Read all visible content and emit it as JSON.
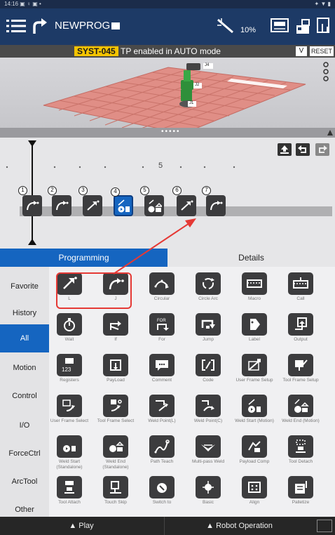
{
  "statusbar": {
    "time": "14:16",
    "left_icons": "▣ ♀ ▣ •",
    "right_icons": "✦ ▼ ▮"
  },
  "topbar": {
    "program_name": "NEWPROG",
    "speed": "10%"
  },
  "alarm": {
    "code": "SYST-045",
    "message": "TP enabled in AUTO mode",
    "expand": "V",
    "reset": "RESET"
  },
  "view3d": {
    "labels": [
      "J4",
      "J2",
      "J1"
    ]
  },
  "splitter": {
    "dots": "•••••"
  },
  "timeline": {
    "ruler_tick": "5",
    "commands": [
      {
        "num": "1",
        "icon": "joint-move-icon"
      },
      {
        "num": "2",
        "icon": "joint-move-icon"
      },
      {
        "num": "3",
        "icon": "linear-move-icon"
      },
      {
        "num": "4",
        "icon": "weld-start-icon"
      },
      {
        "num": "5",
        "icon": "weld-end-icon"
      },
      {
        "num": "6",
        "icon": "linear-move-icon"
      },
      {
        "num": "7",
        "icon": "joint-move-icon"
      }
    ],
    "selected_index": 4
  },
  "tabs": {
    "programming": "Programming",
    "details": "Details"
  },
  "categories": [
    "Favorite",
    "History",
    "All",
    "Motion",
    "Control",
    "I/O",
    "ForceCtrl",
    "ArcTool",
    "Other"
  ],
  "active_category": "All",
  "grid": [
    [
      "L",
      "J",
      "Circular",
      "Circle Arc",
      "Macro",
      "Call"
    ],
    [
      "Wait",
      "If",
      "For",
      "Jump",
      "Label",
      "Output"
    ],
    [
      "Registers",
      "PayLoad",
      "Comment",
      "Code",
      "User Frame Setup",
      "Tool Frame Setup"
    ],
    [
      "User Frame Select",
      "Tool Frame Select",
      "Weld Point(L)",
      "Weld Point(C)",
      "Weld Start (Motion)",
      "Weld End (Motion)"
    ],
    [
      "Weld Start (Standalone)",
      "Weld End (Standalone)",
      "Path Teach",
      "Multi-pass Weld",
      "Payload Comp",
      "Tool Detach"
    ],
    [
      "Tool Attach",
      "Touch Skip",
      "Switch to",
      "Basic",
      "Align",
      "Palletize"
    ]
  ],
  "registers_icon_text": "123",
  "for_icon_text": "FOR",
  "bottombar": {
    "play": "▲ Play",
    "robot": "▲ Robot Operation"
  },
  "colors": {
    "accent": "#1565c0",
    "topbar": "#1d3a66",
    "alarm_code_bg": "#f5c400",
    "annotation": "#e53935"
  }
}
